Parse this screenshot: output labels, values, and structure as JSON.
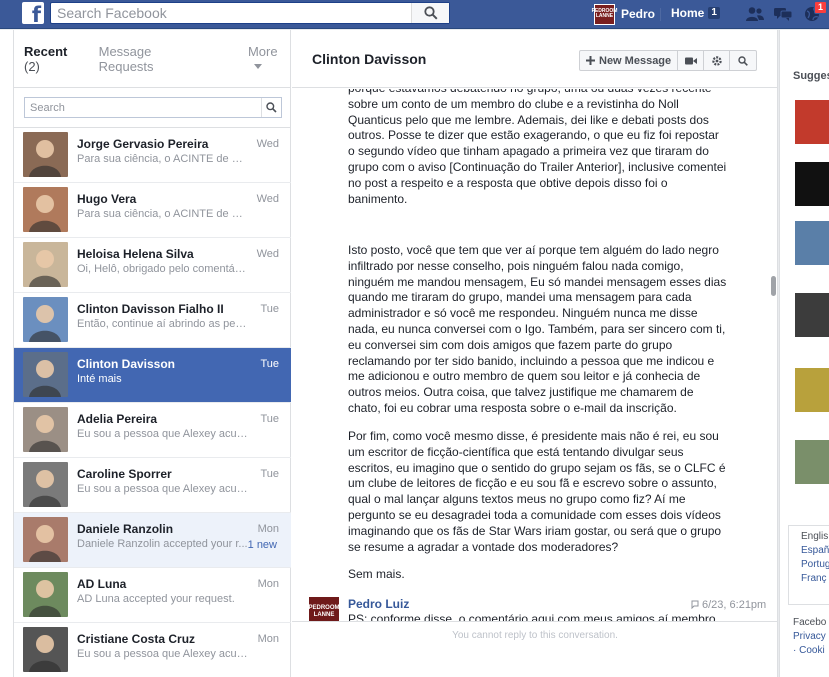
{
  "topbar": {
    "logo": "f",
    "search_placeholder": "Search Facebook",
    "user_name": "Pedro",
    "user_avatar_text": "PEDROOM LANNE",
    "home_label": "Home",
    "home_count": "1",
    "notifications_count": "1"
  },
  "left": {
    "recent_label": "Recent",
    "recent_count": "(2)",
    "requests_label": "Message Requests",
    "more_label": "More",
    "search_placeholder": "Search",
    "threads": [
      {
        "name": "Jorge Gervasio Pereira",
        "snippet": "Para sua ciência, o ACINTE de Cl...",
        "time": "Wed",
        "avatar_color": "#8a6a55"
      },
      {
        "name": "Hugo Vera",
        "snippet": "Para sua ciência, o ACINTE de Cl...",
        "time": "Wed",
        "avatar_color": "#b07a5c"
      },
      {
        "name": "Heloisa Helena Silva",
        "snippet": "Oi, Helô, obrigado pelo comentári...",
        "time": "Wed",
        "avatar_color": "#c9b69a"
      },
      {
        "name": "Clinton Davisson Fialho II",
        "snippet": "Então, continue aí abrindo as pern...",
        "time": "Tue",
        "avatar_color": "#6b8fbf"
      },
      {
        "name": "Clinton Davisson",
        "snippet": "Inté mais",
        "time": "Tue",
        "avatar_color": "#5b6e8a"
      },
      {
        "name": "Adelia Pereira",
        "snippet": "Eu sou a pessoa que Alexey acus...",
        "time": "Tue",
        "avatar_color": "#9b8f85"
      },
      {
        "name": "Caroline Sporrer",
        "snippet": "Eu sou a pessoa que Alexey acus...",
        "time": "Tue",
        "avatar_color": "#7a7a7a"
      },
      {
        "name": "Daniele Ranzolin",
        "snippet": "Daniele Ranzolin accepted your r...",
        "time": "Mon",
        "new_tag": "1 new",
        "avatar_color": "#a97b6b"
      },
      {
        "name": "AD Luna",
        "snippet": "AD Luna accepted your request.",
        "time": "Mon",
        "avatar_color": "#6d8a5e"
      },
      {
        "name": "Cristiane Costa Cruz",
        "snippet": "Eu sou a pessoa que Alexey acus...",
        "time": "Mon",
        "avatar_color": "#555555"
      }
    ]
  },
  "conversation": {
    "title": "Clinton Davisson",
    "new_message_label": "New Message",
    "paragraphs": [
      "porque estávamos debatendo no grupo, uma ou duas vezes recente sobre um conto de um membro do clube e a revistinha do Noll Quanticus pelo que me lembre. Ademais, dei like e debati posts dos outros. Posse te dizer que estão exagerando, o que eu fiz foi repostar o segundo vídeo que tinham apagado a primeira vez que tiraram do grupo com o aviso [Continuação do Trailer Anterior], inclusive comentei no post a respeito e a resposta que obtive depois disso foi o banimento.",
      "Isto posto, você que tem que ver aí porque tem alguém do lado negro infiltrado por nesse conselho, pois ninguém falou nada comigo, ninguém me mandou mensagem,  Eu só mandei mensagem esses dias quando me tiraram do grupo, mandei uma mensagem para cada administrador e só você me respondeu. Ninguém nunca me disse nada, eu nunca conversei com o Igo. Também, para ser sincero com ti, eu conversei sim com dois amigos que fazem parte do grupo reclamando por ter sido banido, incluindo a pessoa que me indicou e me adicionou e outro membro de quem sou leitor e já conhecia de outros meios.  Outra coisa, que talvez justifique me chamarem de chato, foi eu cobrar uma resposta sobre o e-mail da inscrição.",
      "Por fim, como você mesmo disse, é presidente mais não é rei, eu sou um escritor de ficção-científica que está tentando divulgar seus escritos, eu imagino que o sentido do grupo sejam os fãs, se o CLFC é um clube de leitores de ficção e eu sou fã e escrevo sobre o assunto, qual o mal lançar alguns textos meus no grupo como fiz? Aí me pergunto se eu desagradei toda a comunidade com esses dois vídeos imaginando que os fãs de Star Wars iriam gostar, ou será que o grupo se resume a agradar a vontade dos moderadores?",
      "Sem mais."
    ],
    "last_sender": "Pedro Luiz",
    "last_sender_avatar_text": "PEDROOM LANNE",
    "last_time": "6/23, 6:21pm",
    "last_message": "PS: conforme disse, o comentário aqui com meus amigos aí membro do grupo, a questão que tá na mesa é: \"Num lugar que os caras",
    "cannot_reply": "You cannot reply to this conversation."
  },
  "sidebar": {
    "suggested_title": "Sugges",
    "thumb_colors": [
      "#c23a2c",
      "#111111",
      "#5a7fa8",
      "#3c3c3c",
      "#b8a13c",
      "#7a8f6a"
    ],
    "languages": [
      "Englis",
      "Españ",
      "Portug",
      "Franç"
    ],
    "footer_title": "Facebo",
    "footer_links": [
      "Privacy",
      "· Cooki"
    ]
  }
}
